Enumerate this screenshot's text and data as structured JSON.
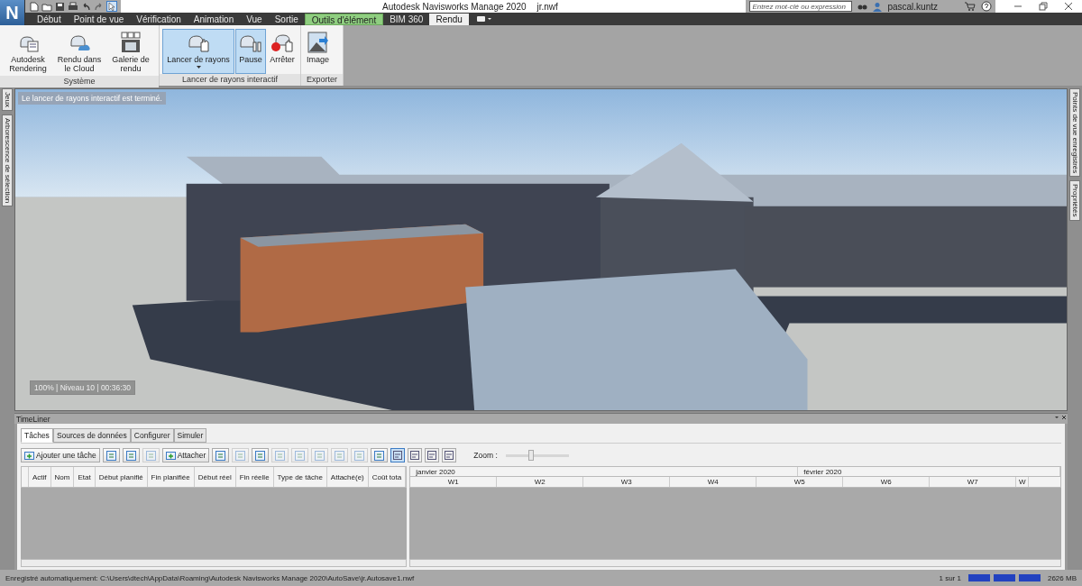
{
  "app_menu": {
    "letter": "N"
  },
  "window": {
    "title": "Autodesk Navisworks Manage 2020",
    "file": "jr.nwf"
  },
  "search": {
    "placeholder": "Entrez mot-clé ou expression"
  },
  "user": {
    "name": "pascal.kuntz"
  },
  "ribbon_tabs": [
    {
      "label": "Début",
      "selected": false,
      "kind": "normal"
    },
    {
      "label": "Point de vue",
      "selected": false,
      "kind": "normal"
    },
    {
      "label": "Vérification",
      "selected": false,
      "kind": "normal"
    },
    {
      "label": "Animation",
      "selected": false,
      "kind": "normal"
    },
    {
      "label": "Vue",
      "selected": false,
      "kind": "normal"
    },
    {
      "label": "Sortie",
      "selected": false,
      "kind": "normal"
    },
    {
      "label": "Outils d'élément",
      "selected": false,
      "kind": "contextual"
    },
    {
      "label": "BIM 360",
      "selected": false,
      "kind": "normal"
    },
    {
      "label": "Rendu",
      "selected": true,
      "kind": "normal"
    }
  ],
  "ribbon_panels": [
    {
      "title": "Système",
      "buttons": [
        {
          "label": "Autodesk Rendering",
          "selected": false,
          "dropdown": false
        },
        {
          "label": "Rendu dans le Cloud",
          "selected": false,
          "dropdown": false
        },
        {
          "label": "Galerie de rendu",
          "selected": false,
          "dropdown": false
        }
      ]
    },
    {
      "title": "Lancer de rayons interactif",
      "buttons": [
        {
          "label": "Lancer de rayons",
          "selected": true,
          "dropdown": true
        },
        {
          "label": "Pause",
          "selected": true,
          "dropdown": false
        },
        {
          "label": "Arrêter",
          "selected": false,
          "dropdown": false
        }
      ]
    },
    {
      "title": "Exporter",
      "buttons": [
        {
          "label": "Image",
          "selected": false,
          "dropdown": false
        }
      ]
    }
  ],
  "side_tabs_left": [
    {
      "label": "Jeux"
    },
    {
      "label": "Arborescence de sélection"
    }
  ],
  "side_tabs_right": [
    {
      "label": "Points de vue enregistrés"
    },
    {
      "label": "Propriétés"
    }
  ],
  "viewport": {
    "status_message": "Le lancer de rayons interactif est terminé.",
    "info": "100% | Niveau 10 | 00:36:30"
  },
  "timeliner": {
    "title": "TimeLiner",
    "tabs": [
      {
        "label": "Tâches",
        "selected": true
      },
      {
        "label": "Sources de données",
        "selected": false
      },
      {
        "label": "Configurer",
        "selected": false
      },
      {
        "label": "Simuler",
        "selected": false
      }
    ],
    "toolbar": [
      {
        "kind": "button",
        "label": "Ajouter une tâche",
        "disabled": false
      },
      {
        "kind": "icon",
        "disabled": false
      },
      {
        "kind": "icon",
        "disabled": false
      },
      {
        "kind": "icon",
        "disabled": true
      },
      {
        "kind": "button",
        "label": "Attacher",
        "disabled": false
      },
      {
        "kind": "icon",
        "disabled": false
      },
      {
        "kind": "icon",
        "disabled": true
      },
      {
        "kind": "icon",
        "disabled": false
      },
      {
        "kind": "icon",
        "disabled": true
      },
      {
        "kind": "icon",
        "disabled": true
      },
      {
        "kind": "icon",
        "disabled": true
      },
      {
        "kind": "icon",
        "disabled": true
      },
      {
        "kind": "icon",
        "disabled": true
      },
      {
        "kind": "icon",
        "disabled": false
      }
    ],
    "view_buttons": [
      {
        "selected": true
      },
      {
        "selected": false
      },
      {
        "selected": false
      },
      {
        "selected": false
      }
    ],
    "zoom": {
      "label": "Zoom :",
      "level": 0.4
    },
    "columns": [
      "Actif",
      "Nom",
      "Etat",
      "Début planifié",
      "Fin planifiée",
      "Début réel",
      "Fin réelle",
      "Type de tâche",
      "Attaché(e)",
      "Coût tota"
    ],
    "months": [
      "janvier 2020",
      "février 2020"
    ],
    "weeks": [
      "W1",
      "W2",
      "W3",
      "W4",
      "W5",
      "W6",
      "W7",
      "W"
    ]
  },
  "status_bar": {
    "autosave": "Enregistré automatiquement: C:\\Users\\dtech\\AppData\\Roaming\\Autodesk Navisworks Manage 2020\\AutoSave\\jr.Autosave1.nwf",
    "page": "1 sur 1",
    "memory": "2626 MB"
  }
}
